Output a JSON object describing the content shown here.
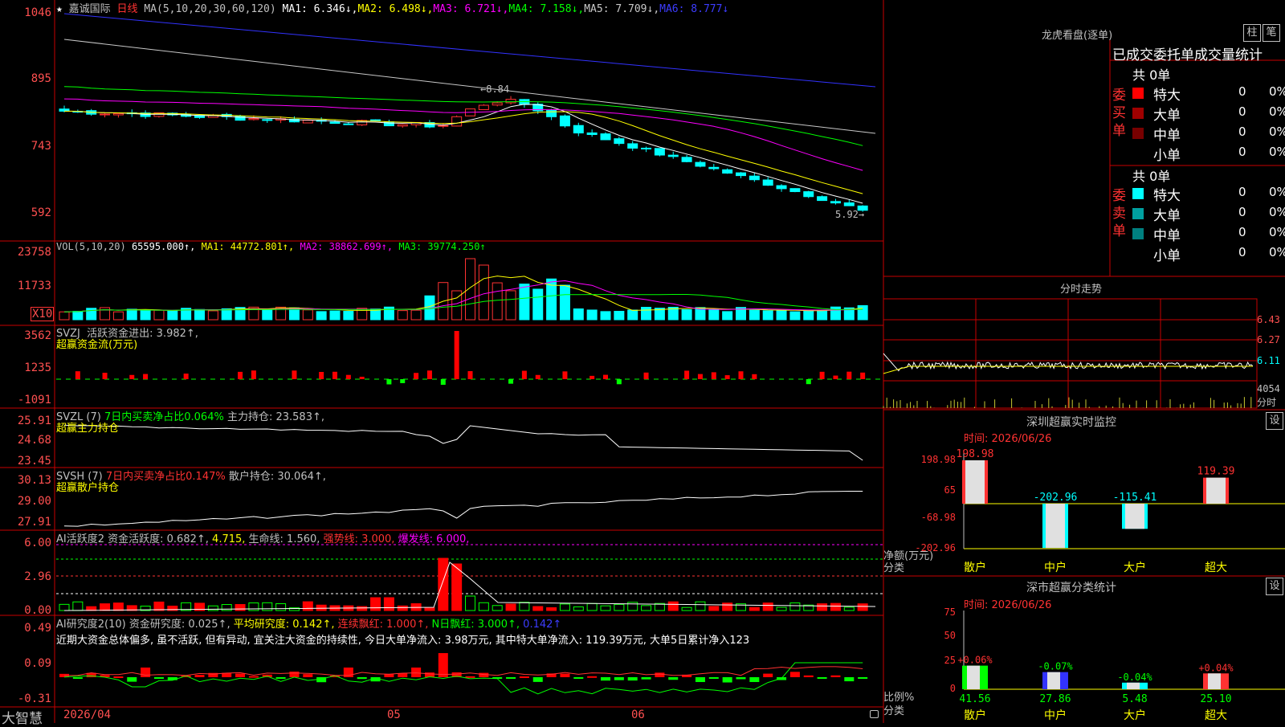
{
  "colors": {
    "up": "#ff3232",
    "down": "#00ffff",
    "grid": "#c80000",
    "axis": "#ff5050",
    "ma1": "#ffffff",
    "ma2": "#ffff00",
    "ma3": "#ff00ff",
    "ma4": "#00ff00",
    "ma5": "#c8c8c8",
    "ma6": "#3232ff"
  },
  "header": {
    "star": "★",
    "stock_name": "嘉诚国际",
    "period": "日线",
    "ma_params": "MA(5,10,20,30,60,120)",
    "ma1": "MA1: 6.346↓,",
    "ma2": "MA2: 6.498↓,",
    "ma3": "MA3: 6.721↓,",
    "ma4": "MA4: 7.158↓,",
    "ma5": "MA5: 7.709↓,",
    "ma6": "MA6: 8.777↓"
  },
  "main_axis": {
    "ticks": [
      "1046",
      "895",
      "743",
      "592"
    ],
    "high_label": "8.84",
    "low_label": "5.92"
  },
  "vol": {
    "title": "VOL(5,10,20)",
    "value": "65595.000↑,",
    "ma1": "MA1: 44772.801↑,",
    "ma2": "MA2: 38862.699↑,",
    "ma3": "MA3: 39774.250↑",
    "ticks": [
      "23758",
      "11733"
    ],
    "unit": "X10"
  },
  "svzj": {
    "title": "SVZJ",
    "line1": "活跃资金进出: 3.982↑,",
    "line2": "超赢资金流(万元)",
    "ticks": [
      "3562",
      "1235",
      "-1091"
    ]
  },
  "svzl": {
    "title": "SVZL (7)",
    "line1a": "7日内买卖净占比0.064%",
    "line1b": "主力持仓: 23.583↑,",
    "line2": "超赢主力持仓",
    "ticks": [
      "25.91",
      "24.68",
      "23.45"
    ]
  },
  "svsh": {
    "title": "SVSH (7)",
    "line1a": "7日内买卖净占比0.147%",
    "line1b": "散户持仓: 30.064↑,",
    "line2": "超赢散户持仓",
    "ticks": [
      "30.13",
      "29.00",
      "27.91"
    ]
  },
  "huoyue": {
    "title": "AI活跃度2",
    "val1": "资金活跃度: 0.682↑,",
    "val2": "4.715,",
    "val3": "生命线: 1.560,",
    "val4": "强势线: 3.000,",
    "val5": "爆发线: 6.000,",
    "ticks": [
      "6.00",
      "2.96",
      "0.00"
    ]
  },
  "yanjiu": {
    "title": "AI研究度2(10)",
    "val1": "资金研究度: 0.025↑,",
    "val2": "平均研究度: 0.142↑,",
    "val3": "连续飘红: 1.000↑,",
    "val4": "N日飘红: 3.000↑,",
    "val5": "0.142↑",
    "comment": "近期大资金总体偏多, 虽不活跃, 但有异动, 宜关注大资金的持续性, 今日大单净流入: 3.98万元, 其中特大单净流入: 119.39万元, 大单5日累计净入123",
    "ticks": [
      "0.49",
      "0.09",
      "-0.31"
    ]
  },
  "bottom": {
    "brand": "大智慧",
    "date1": "2026/04",
    "date2": "05",
    "date3": "06"
  },
  "lhb": {
    "title": "龙虎看盘(逐单)",
    "tab1": "柱",
    "tab2": "笔",
    "subtitle": "已成交委托单成交量统计",
    "buy_label": "委买单",
    "sell_label": "委卖单",
    "buy_total": "共 0单",
    "sell_total": "共 0单",
    "buy_rows": [
      {
        "name": "特大",
        "count": "0",
        "pct": "0%",
        "color": "#ff0000"
      },
      {
        "name": "大单",
        "count": "0",
        "pct": "0%",
        "color": "#a00000"
      },
      {
        "name": "中单",
        "count": "0",
        "pct": "0%",
        "color": "#780000"
      },
      {
        "name": "小单",
        "count": "0",
        "pct": "0%",
        "color": "#000000"
      }
    ],
    "sell_rows": [
      {
        "name": "特大",
        "count": "0",
        "pct": "0%",
        "color": "#00ffff"
      },
      {
        "name": "大单",
        "count": "0",
        "pct": "0%",
        "color": "#00a0a0"
      },
      {
        "name": "中单",
        "count": "0",
        "pct": "0%",
        "color": "#008080"
      },
      {
        "name": "小单",
        "count": "0",
        "pct": "0%",
        "color": "#000000"
      }
    ]
  },
  "fenshi": {
    "title": "分时走势",
    "ticks": [
      "6.43",
      "6.27",
      "6.11"
    ],
    "vol_tick": "4054",
    "vol_unit": "分时"
  },
  "monitor": {
    "title": "深圳超赢实时监控",
    "set": "设",
    "time": "时间: 2026/06/26",
    "ticks": [
      "198.98",
      "65",
      "-68.98",
      "-202.96"
    ],
    "unit1": "净额(万元)",
    "unit2": "分类",
    "bars": [
      {
        "cat": "散户",
        "value": 198.98,
        "label": "198.98"
      },
      {
        "cat": "中户",
        "value": -202.96,
        "label": "-202.96"
      },
      {
        "cat": "大户",
        "value": -115.41,
        "label": "-115.41"
      },
      {
        "cat": "超大",
        "value": 119.39,
        "label": "119.39"
      }
    ]
  },
  "stats": {
    "title": "深市超赢分类统计",
    "set": "设",
    "time": "时间: 2026/06/26",
    "ticks": [
      "75",
      "50",
      "25",
      "0"
    ],
    "unit1": "比例%",
    "unit2": "分类",
    "bars": [
      {
        "cat": "散户",
        "value": 41.56,
        "label": "41.56",
        "delta": "+0.06%"
      },
      {
        "cat": "中户",
        "value": 27.86,
        "label": "27.86",
        "delta": "-0.07%"
      },
      {
        "cat": "大户",
        "value": 5.48,
        "label": "5.48",
        "delta": "-0.04%"
      },
      {
        "cat": "超大",
        "value": 25.1,
        "label": "25.10",
        "delta": "+0.04%"
      }
    ]
  }
}
